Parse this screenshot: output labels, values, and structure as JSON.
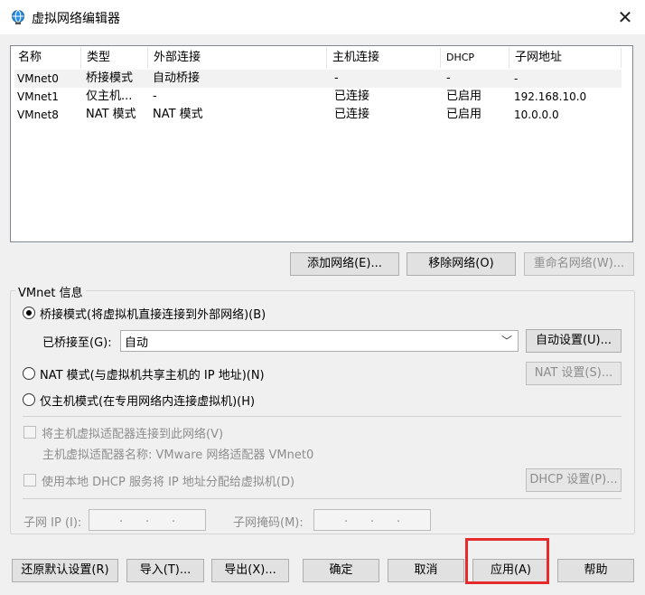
{
  "window": {
    "title": "虚拟网络编辑器",
    "close_symbol": "✕"
  },
  "list": {
    "columns": [
      "名称",
      "类型",
      "外部连接",
      "主机连接",
      "DHCP",
      "子网地址"
    ],
    "rows": [
      [
        "VMnet0",
        "桥接模式",
        "自动桥接",
        "-",
        "-",
        "-"
      ],
      [
        "VMnet1",
        "仅主机...",
        "-",
        "已连接",
        "已启用",
        "192.168.10.0"
      ],
      [
        "VMnet8",
        "NAT 模式",
        "NAT 模式",
        "已连接",
        "已启用",
        "10.0.0.0"
      ]
    ]
  },
  "list_buttons": {
    "add": "添加网络(E)...",
    "remove": "移除网络(O)",
    "rename": "重命名网络(W)..."
  },
  "info": {
    "group_label": "VMnet 信息",
    "bridged_label": "桥接模式(将虚拟机直接连接到外部网络)(B)",
    "bridged_to_label": "已桥接至(G):",
    "bridged_to_value": "自动",
    "auto_settings": "自动设置(U)...",
    "nat_label": "NAT 模式(与虚拟机共享主机的 IP 地址)(N)",
    "nat_settings": "NAT 设置(S)...",
    "hostonly_label": "仅主机模式(在专用网络内连接虚拟机)(H)",
    "connect_adapter_label": "将主机虚拟适配器连接到此网络(V)",
    "adapter_name_label": "主机虚拟适配器名称: VMware 网络适配器 VMnet0",
    "dhcp_label": "使用本地 DHCP 服务将 IP 地址分配给虚拟机(D)",
    "dhcp_settings": "DHCP 设置(P)...",
    "subnet_ip_label": "子网 IP (I):",
    "subnet_mask_label": "子网掩码(M):",
    "ip_dot": "."
  },
  "bottom_buttons": {
    "restore": "还原默认设置(R)",
    "import": "导入(T)...",
    "export": "导出(X)...",
    "ok": "确定",
    "cancel": "取消",
    "apply": "应用(A)",
    "help": "帮助"
  },
  "colors": {
    "highlight": "#e52b2b",
    "accent_icon": "#1e7fd6"
  }
}
